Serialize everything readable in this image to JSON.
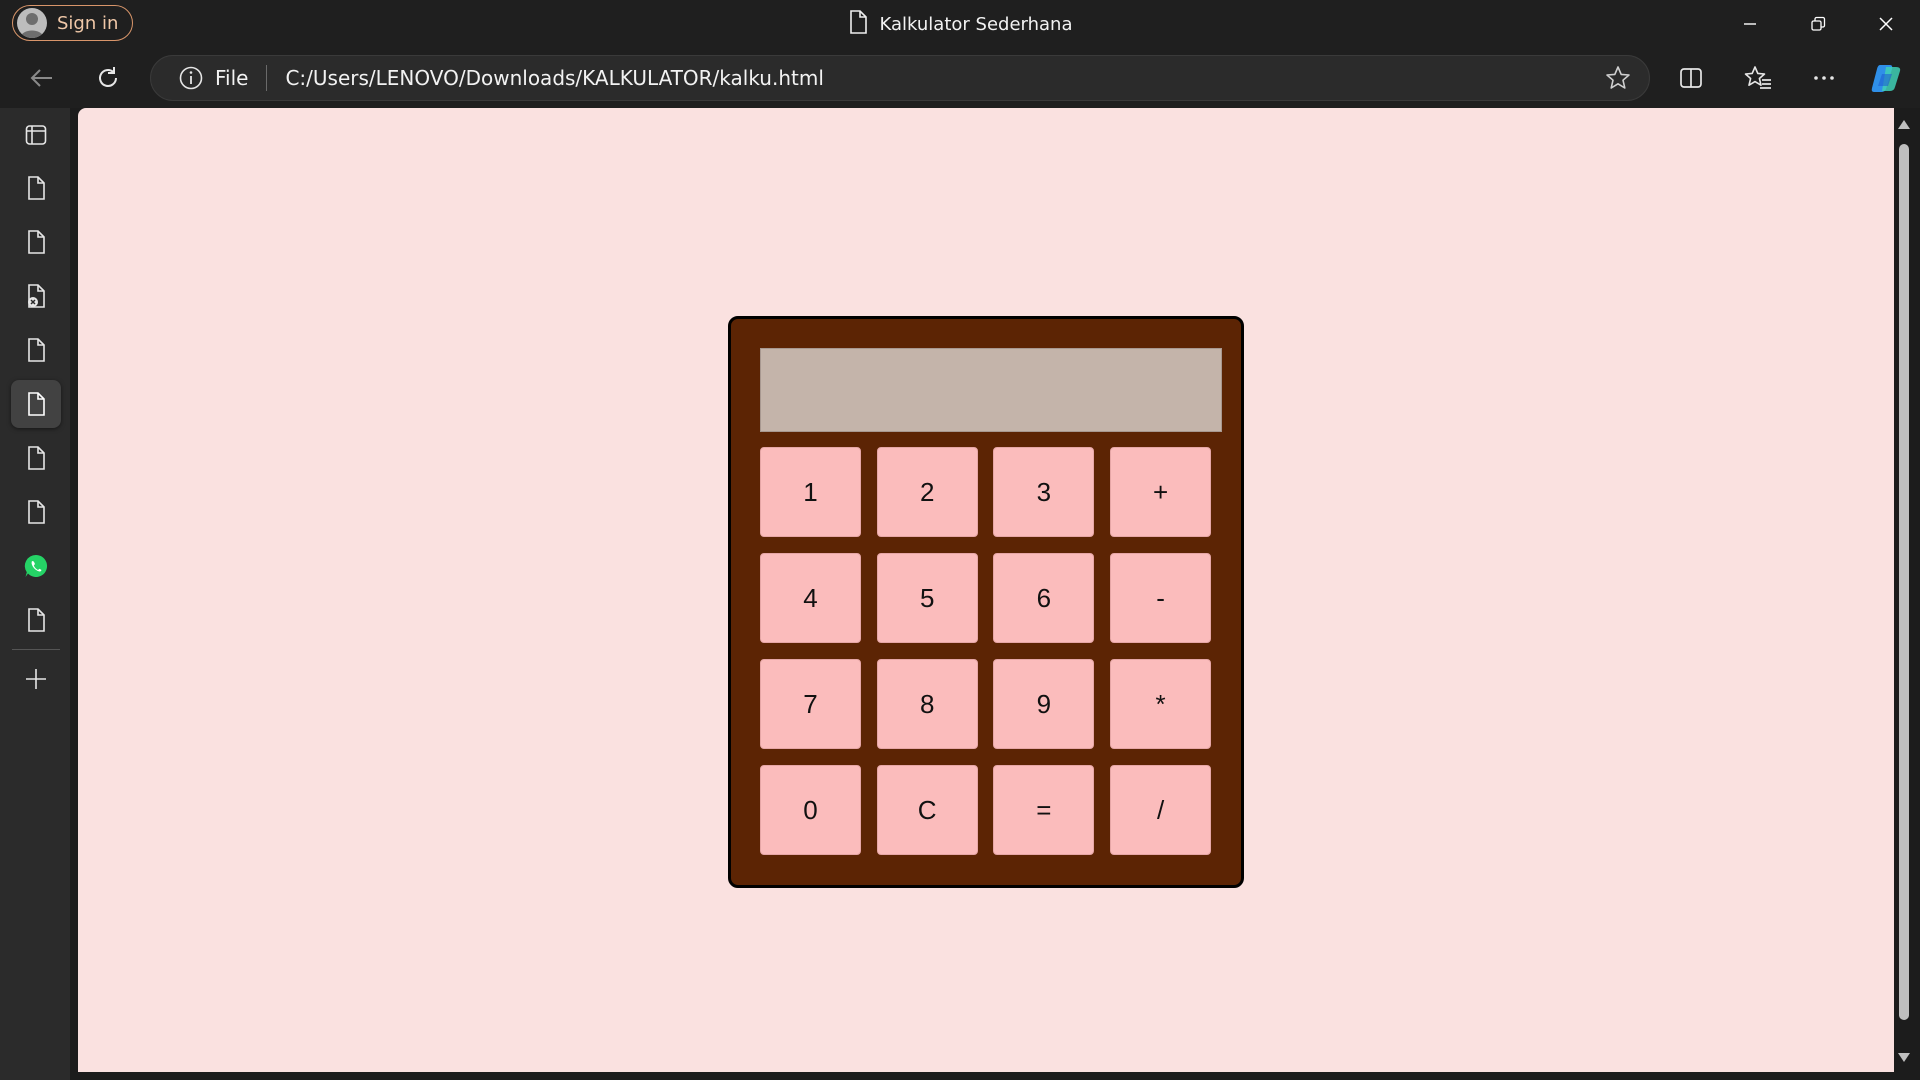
{
  "window": {
    "title": "Kalkulator Sederhana",
    "sign_in_label": "Sign in",
    "controls": [
      "minimize-icon",
      "restore-icon",
      "close-icon"
    ]
  },
  "toolbar": {
    "back_icon": "back-arrow-icon",
    "reload_icon": "refresh-icon",
    "address": {
      "scheme_label": "File",
      "url": "C:/Users/LENOVO/Downloads/KALKULATOR/kalku.html"
    },
    "right_icons": [
      "split-screen-icon",
      "favorites-icon",
      "more-icon",
      "copilot-icon"
    ]
  },
  "sidebar": {
    "items": [
      {
        "icon": "tab-actions-icon",
        "active": false
      },
      {
        "icon": "page-icon",
        "active": false
      },
      {
        "icon": "page-icon",
        "active": false
      },
      {
        "icon": "page-error-icon",
        "active": false
      },
      {
        "icon": "page-icon",
        "active": false
      },
      {
        "icon": "page-icon",
        "active": true
      },
      {
        "icon": "page-icon",
        "active": false
      },
      {
        "icon": "page-icon",
        "active": false
      },
      {
        "icon": "whatsapp-icon",
        "active": false
      },
      {
        "icon": "page-icon",
        "active": false
      }
    ],
    "add_icon": "plus-icon"
  },
  "page": {
    "background": "#fae1e0",
    "calculator": {
      "display_value": "",
      "body_color": "#5c2404",
      "key_color": "#fbbcbc",
      "display_color": "#c4b4aa",
      "keys": [
        "1",
        "2",
        "3",
        "+",
        "4",
        "5",
        "6",
        "-",
        "7",
        "8",
        "9",
        "*",
        "0",
        "C",
        "=",
        "/"
      ]
    }
  }
}
